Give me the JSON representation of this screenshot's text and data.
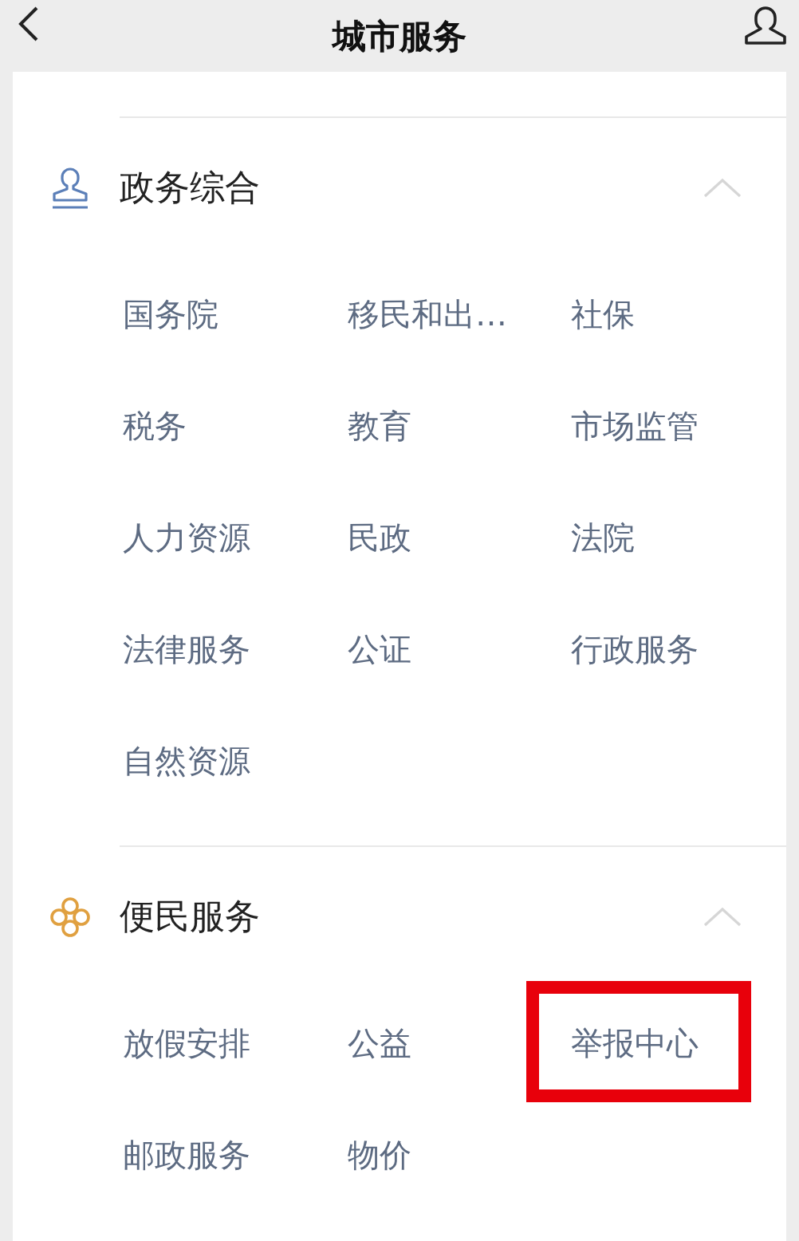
{
  "header": {
    "title": "城市服务"
  },
  "sections": [
    {
      "kind": "stamp",
      "title": "政务综合",
      "expanded": true,
      "items": [
        {
          "label": "国务院",
          "highlighted": false
        },
        {
          "label": "移民和出…",
          "highlighted": false
        },
        {
          "label": "社保",
          "highlighted": false
        },
        {
          "label": "税务",
          "highlighted": false
        },
        {
          "label": "教育",
          "highlighted": false
        },
        {
          "label": "市场监管",
          "highlighted": false
        },
        {
          "label": "人力资源",
          "highlighted": false
        },
        {
          "label": "民政",
          "highlighted": false
        },
        {
          "label": "法院",
          "highlighted": false
        },
        {
          "label": "法律服务",
          "highlighted": false
        },
        {
          "label": "公证",
          "highlighted": false
        },
        {
          "label": "行政服务",
          "highlighted": false
        },
        {
          "label": "自然资源",
          "highlighted": false
        }
      ]
    },
    {
      "kind": "knot",
      "title": "便民服务",
      "expanded": true,
      "items": [
        {
          "label": "放假安排",
          "highlighted": false
        },
        {
          "label": "公益",
          "highlighted": false
        },
        {
          "label": "举报中心",
          "highlighted": true
        },
        {
          "label": "邮政服务",
          "highlighted": false
        },
        {
          "label": "物价",
          "highlighted": false
        }
      ]
    }
  ]
}
